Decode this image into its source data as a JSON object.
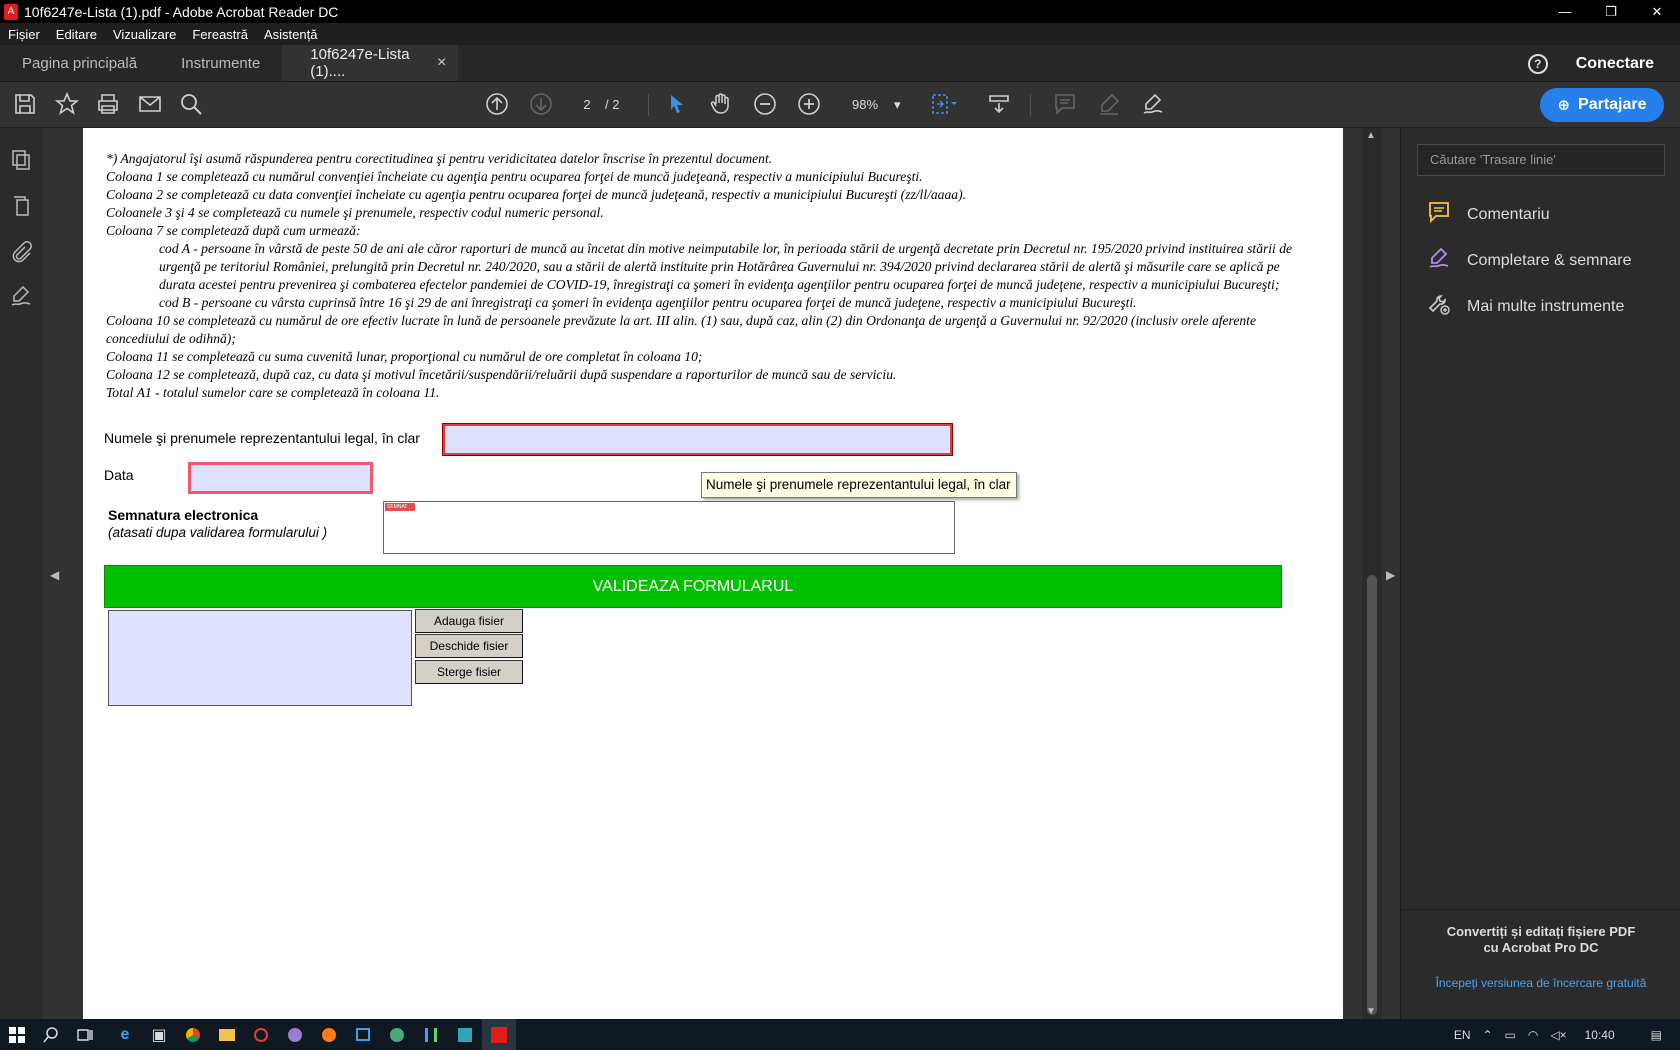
{
  "window": {
    "title": "10f6247e-Lista (1).pdf - Adobe Acrobat Reader DC",
    "app_icon": "acrobat-icon",
    "controls": [
      "—",
      "❐",
      "✕"
    ]
  },
  "menu": [
    "Fișier",
    "Editare",
    "Vizualizare",
    "Fereastră",
    "Asistență"
  ],
  "tabs": {
    "home": "Pagina principală",
    "tools": "Instrumente",
    "document": "10f6247e-Lista (1)....",
    "close": "×",
    "help": "?",
    "connect": "Conectare"
  },
  "toolbar": {
    "page_current": "2",
    "page_total": "/ 2",
    "zoom": "98%",
    "zoom_caret": "▾",
    "share": "Partajare",
    "accent": "#2680eb"
  },
  "right_panel": {
    "search_placeholder": "Căutare 'Trasare linie'",
    "items": [
      {
        "label": "Comentariu",
        "icon": "comment-icon",
        "color": "#f5c542"
      },
      {
        "label": "Completare & semnare",
        "icon": "fill-sign-icon",
        "color": "#b48cf0"
      },
      {
        "label": "Mai multe instrumente",
        "icon": "more-tools-icon",
        "color": "#ccc"
      }
    ],
    "promo": "Convertiți și editați fișiere PDF cu Acrobat Pro DC",
    "trial": "Începeți versiunea de încercare gratuită"
  },
  "document": {
    "notes": [
      "*) Angajatorul îşi asumă răspunderea pentru corectitudinea şi pentru veridicitatea datelor înscrise în prezentul document.",
      "Coloana 1 se completează cu numărul convenţiei încheiate cu agenţia pentru ocuparea forţei de muncă judeţeană, respectiv a municipiului Bucureşti.",
      "Coloana 2 se completează cu data convenţiei încheiate cu agenţia pentru ocuparea forţei de muncă judeţeană, respectiv a municipiului Bucureşti (zz/ll/aaaa).",
      "Coloanele 3 şi 4 se completează cu numele şi prenumele, respectiv codul numeric personal.",
      "Coloana 7 se completează după cum urmează:"
    ],
    "cod_a": "cod A - persoane în vârstă de peste 50 de ani ale căror raporturi de muncă au încetat din motive neimputabile lor, în perioada stării de urgenţă decretate prin Decretul nr. 195/2020 privind instituirea stării de urgenţă pe teritoriul României, prelungită prin Decretul nr. 240/2020, sau a stării de alertă instituite prin Hotărârea Guvernului nr.  394/2020 privind  declararea stării de alertă şi măsurile care  se  aplică pe  durata acestei pentru  prevenirea şi combaterea efectelor  pandemiei de  COVID-19, înregistraţi ca şomeri în evidenţa agenţiilor pentru ocuparea forţei de muncă judeţene, respectiv a municipiului Bucureşti;",
    "cod_b": "cod B - persoane cu vârsta cuprinsă între 16 şi 29 de ani înregistraţi ca şomeri în evidenţa agenţiilor pentru ocuparea forţei de muncă judeţene, respectiv a municipiului Bucureşti.",
    "notes_after": [
      "Coloana 10 se completează cu numărul de ore efectiv lucrate în lună de persoanele prevăzute la art. III alin. (1) sau, după caz, alin (2) din Ordonanţa de urgenţă a Guvernului nr. 92/2020 (inclusiv orele aferente concediului de odihnă);",
      "Coloana 11 se completează cu suma cuvenită lunar, proporţional cu numărul de ore completat în coloana 10;",
      "Coloana 12 se completează, după caz, cu data şi motivul încetării/suspendării/reluării după suspendare a raporturilor de muncă sau de serviciu.",
      "Total A1 - totalul sumelor care se completează în coloana 11."
    ],
    "rep_label": "Numele şi prenumele reprezentantului legal, în clar",
    "rep_value": "",
    "date_label": "Data",
    "date_value": "",
    "sig_label": "Semnatura electronica",
    "sig_hint": "(atasati dupa validarea formularului )",
    "sig_flag": "SEMNAT",
    "tooltip": "Numele şi prenumele reprezentantului legal, în clar",
    "validate": "VALIDEAZA FORMULARUL",
    "validate_color": "#00c000",
    "add_file": "Adauga fisier",
    "open_file": "Deschide fisier",
    "delete_file": "Sterge fisier"
  },
  "taskbar": {
    "lang": "EN",
    "time": "10:40"
  }
}
